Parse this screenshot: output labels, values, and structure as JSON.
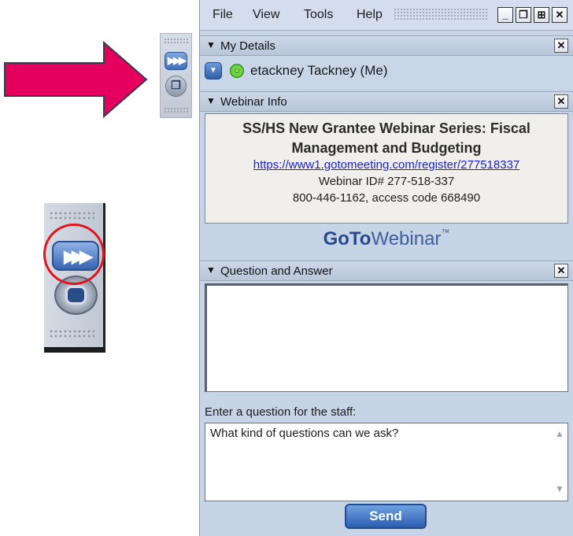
{
  "menu": {
    "file": "File",
    "view": "View",
    "tools": "Tools",
    "help": "Help"
  },
  "window_buttons": {
    "minimize": "_",
    "restore": "❐",
    "pin": "⊞",
    "close": "✕"
  },
  "my_details": {
    "title": "My Details",
    "user": "etackney Tackney (Me)"
  },
  "webinar_info": {
    "title": "Webinar Info",
    "name": "SS/HS New Grantee Webinar Series: Fiscal Management and Budgeting",
    "link": "https://www1.gotomeeting.com/register/277518337",
    "webinar_id": "Webinar ID# 277-518-337",
    "phone": "800-446-1162, access code 668490"
  },
  "brand": {
    "goto": "GoTo",
    "webinar": "Webinar",
    "tm": "™"
  },
  "qa": {
    "title": "Question and Answer",
    "ask_label": "Enter a question for the staff:",
    "question_value": "What kind of questions can we ask?",
    "send_label": "Send"
  },
  "colors": {
    "arrow": "#e4005c",
    "highlight_circle": "#e4101a",
    "panel_bg": "#c7d4e6",
    "send": "#3b6fc0"
  },
  "icons": {
    "expand": "double-chevron-right-icon",
    "restore": "restore-window-icon",
    "status": "smiley-icon"
  }
}
